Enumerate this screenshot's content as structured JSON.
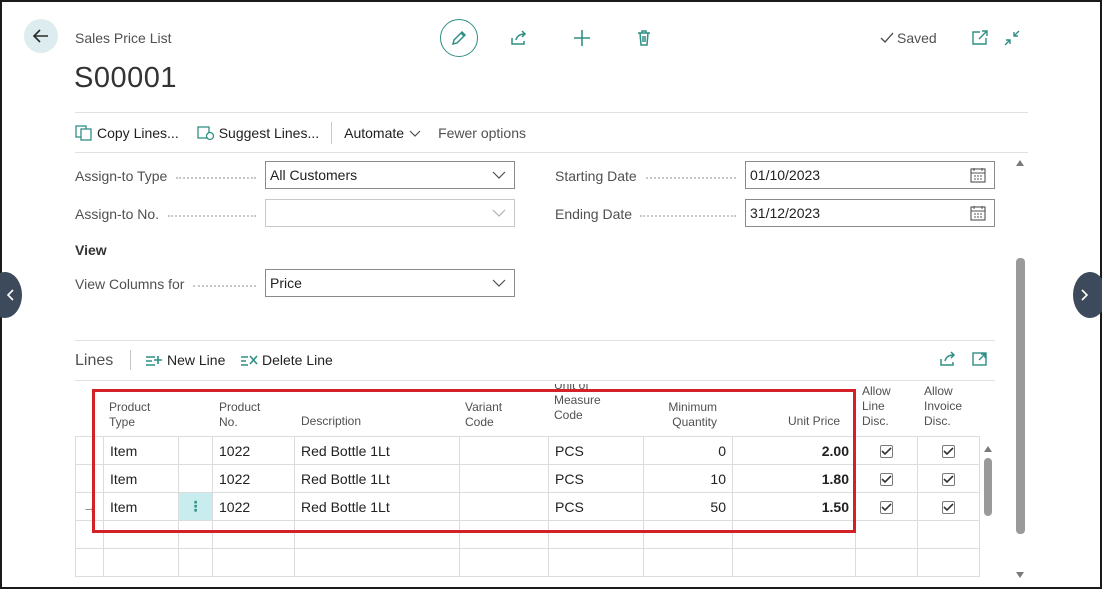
{
  "header": {
    "breadcrumb": "Sales Price List",
    "record_no": "S00001",
    "status": "Saved"
  },
  "actions": {
    "copy_lines": "Copy Lines...",
    "suggest_lines": "Suggest Lines...",
    "automate": "Automate",
    "fewer_options": "Fewer options"
  },
  "fields": {
    "assign_to_type_label": "Assign-to Type",
    "assign_to_type_value": "All Customers",
    "assign_to_no_label": "Assign-to No.",
    "assign_to_no_value": "",
    "starting_date_label": "Starting Date",
    "starting_date_value": "01/10/2023",
    "ending_date_label": "Ending Date",
    "ending_date_value": "31/12/2023",
    "view_heading": "View",
    "view_columns_label": "View Columns for",
    "view_columns_value": "Price"
  },
  "lines": {
    "title": "Lines",
    "new_line": "New Line",
    "delete_line": "Delete Line",
    "columns": {
      "product_type": [
        "Product",
        "Type"
      ],
      "product_no": [
        "Product",
        "No."
      ],
      "description": "Description",
      "variant_code": [
        "Variant",
        "Code"
      ],
      "uom_code": [
        "Unit of",
        "Measure",
        "Code"
      ],
      "min_qty": [
        "Minimum",
        "Quantity"
      ],
      "unit_price": "Unit Price",
      "allow_line_disc": [
        "Allow",
        "Line",
        "Disc."
      ],
      "allow_invoice_disc": [
        "Allow",
        "Invoice",
        "Disc."
      ]
    },
    "rows": [
      {
        "product_type": "Item",
        "product_no": "1022",
        "description": "Red Bottle 1Lt",
        "variant_code": "",
        "uom": "PCS",
        "min_qty": "0",
        "unit_price": "2.00",
        "allow_line_disc": true,
        "allow_invoice_disc": true
      },
      {
        "product_type": "Item",
        "product_no": "1022",
        "description": "Red Bottle 1Lt",
        "variant_code": "",
        "uom": "PCS",
        "min_qty": "10",
        "unit_price": "1.80",
        "allow_line_disc": true,
        "allow_invoice_disc": true
      },
      {
        "product_type": "Item",
        "product_no": "1022",
        "description": "Red Bottle 1Lt",
        "variant_code": "",
        "uom": "PCS",
        "min_qty": "50",
        "unit_price": "1.50",
        "allow_line_disc": true,
        "allow_invoice_disc": true
      }
    ]
  },
  "colors": {
    "accent": "#2f8f84",
    "highlight_box": "#d42027",
    "selected_cell": "#c9ecef"
  }
}
